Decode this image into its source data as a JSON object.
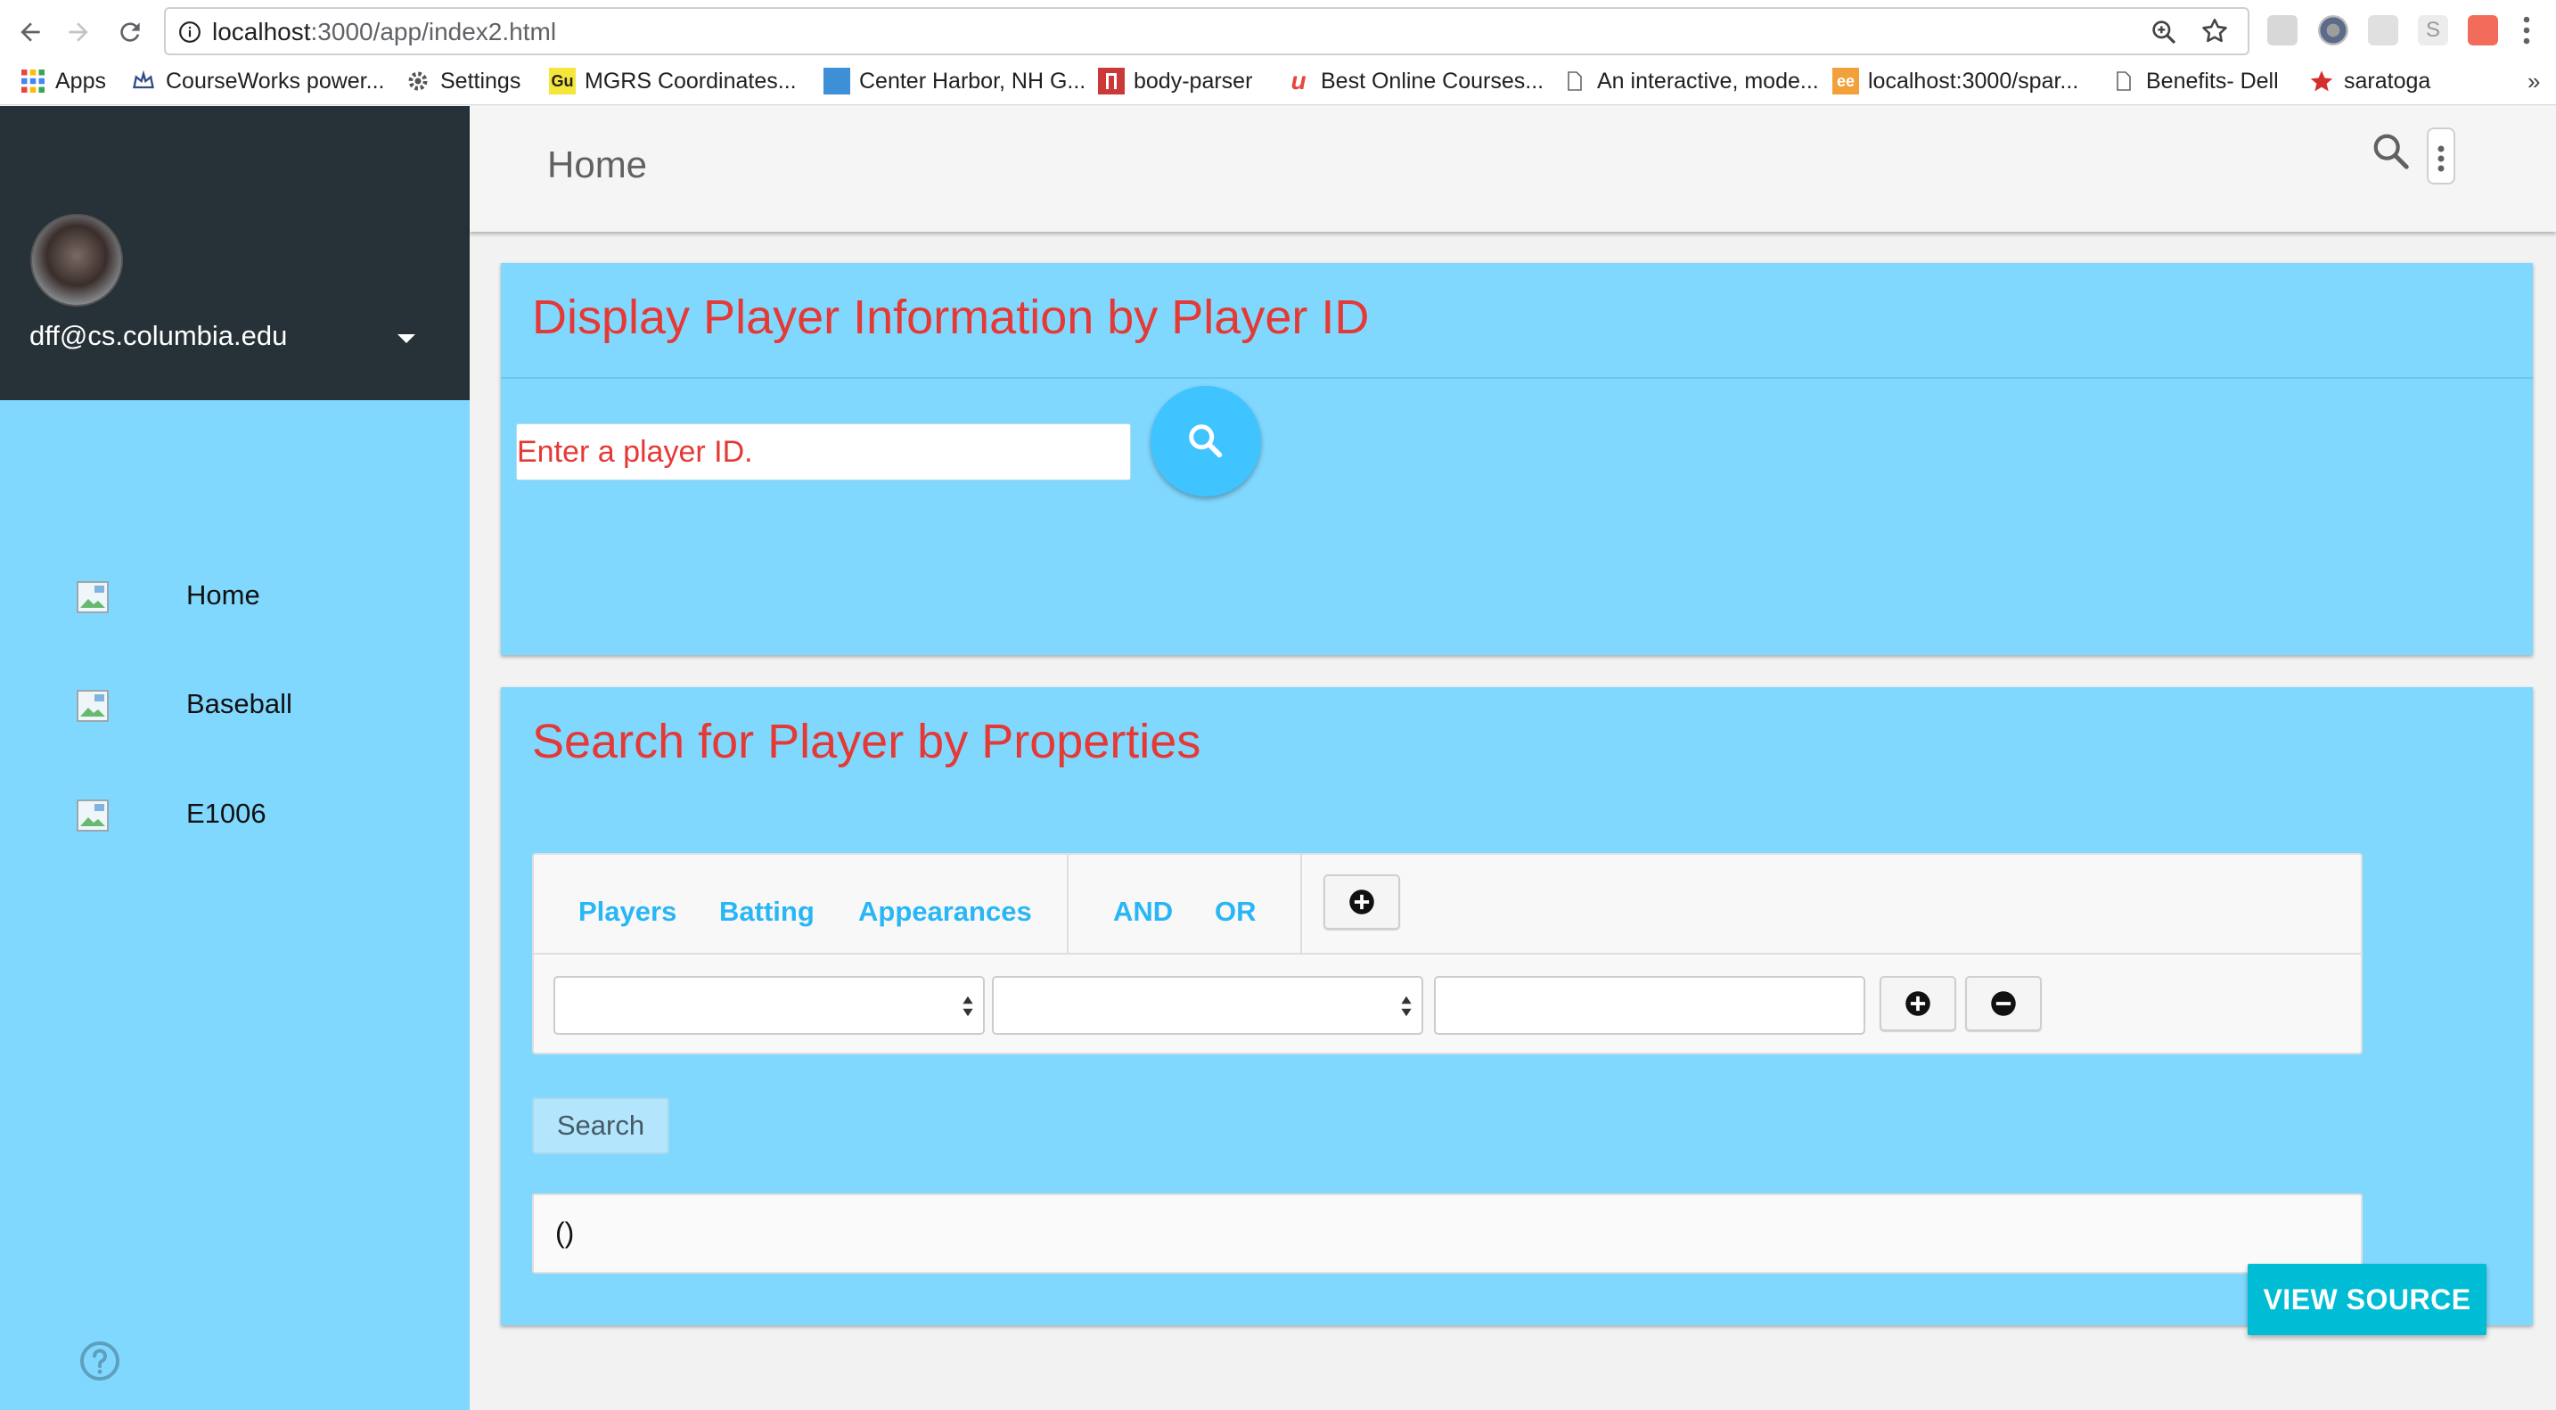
{
  "browser": {
    "url_host": "localhost",
    "url_rest": ":3000/app/index2.html",
    "bookmarks": [
      {
        "label": "Apps",
        "icon": "apps-grid-icon"
      },
      {
        "label": "CourseWorks power...",
        "icon": "crown-icon"
      },
      {
        "label": "Settings",
        "icon": "gear-icon"
      },
      {
        "label": "MGRS Coordinates...",
        "icon": "gu-logo-icon"
      },
      {
        "label": "Center Harbor, NH G...",
        "icon": "map-icon"
      },
      {
        "label": "body-parser",
        "icon": "npm-icon"
      },
      {
        "label": "Best Online Courses...",
        "icon": "udemy-icon"
      },
      {
        "label": "An interactive, mode...",
        "icon": "page-icon"
      },
      {
        "label": "localhost:3000/spar...",
        "icon": "ee-icon"
      },
      {
        "label": "Benefits- Dell",
        "icon": "page-icon"
      },
      {
        "label": "saratoga",
        "icon": "red-star-icon"
      }
    ],
    "more_bookmarks": "»"
  },
  "sidebar": {
    "email": "dff@cs.columbia.edu",
    "items": [
      {
        "label": "Home"
      },
      {
        "label": "Baseball"
      },
      {
        "label": "E1006"
      }
    ]
  },
  "appbar": {
    "title": "Home"
  },
  "player_id_card": {
    "title": "Display Player Information by Player ID",
    "input_placeholder": "Enter a player ID."
  },
  "search_card": {
    "title": "Search for Player by Properties",
    "tabs": [
      "Players",
      "Batting",
      "Appearances"
    ],
    "logic": [
      "AND",
      "OR"
    ],
    "search_label": "Search",
    "result_text": "()"
  },
  "view_source_label": "VIEW SOURCE",
  "colors": {
    "sidebar_bg": "#80d8ff",
    "sidebar_header_bg": "#263238",
    "card_bg": "#80d8ff",
    "title_red": "#e53935",
    "accent_blue": "#40c4ff",
    "view_source_bg": "#00bcd4"
  }
}
